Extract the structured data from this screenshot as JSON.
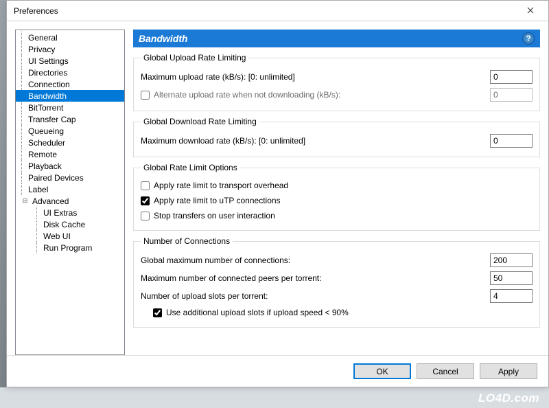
{
  "window": {
    "title": "Preferences"
  },
  "sidebar": {
    "items": [
      {
        "label": "General"
      },
      {
        "label": "Privacy"
      },
      {
        "label": "UI Settings"
      },
      {
        "label": "Directories"
      },
      {
        "label": "Connection"
      },
      {
        "label": "Bandwidth",
        "selected": true
      },
      {
        "label": "BitTorrent"
      },
      {
        "label": "Transfer Cap"
      },
      {
        "label": "Queueing"
      },
      {
        "label": "Scheduler"
      },
      {
        "label": "Remote"
      },
      {
        "label": "Playback"
      },
      {
        "label": "Paired Devices"
      },
      {
        "label": "Label"
      },
      {
        "label": "Advanced",
        "expandable": true,
        "expanded": true,
        "children": [
          {
            "label": "UI Extras"
          },
          {
            "label": "Disk Cache"
          },
          {
            "label": "Web UI"
          },
          {
            "label": "Run Program"
          }
        ]
      }
    ]
  },
  "panel": {
    "title": "Bandwidth",
    "groups": {
      "upload": {
        "legend": "Global Upload Rate Limiting",
        "max_label": "Maximum upload rate (kB/s): [0: unlimited]",
        "max_value": "0",
        "alt_label": "Alternate upload rate when not downloading (kB/s):",
        "alt_checked": false,
        "alt_value": "0"
      },
      "download": {
        "legend": "Global Download Rate Limiting",
        "max_label": "Maximum download rate (kB/s): [0: unlimited]",
        "max_value": "0"
      },
      "options": {
        "legend": "Global Rate Limit Options",
        "overhead_label": "Apply rate limit to transport overhead",
        "overhead_checked": false,
        "utp_label": "Apply rate limit to uTP connections",
        "utp_checked": true,
        "stop_label": "Stop transfers on user interaction",
        "stop_checked": false
      },
      "connections": {
        "legend": "Number of Connections",
        "global_label": "Global maximum number of connections:",
        "global_value": "200",
        "peers_label": "Maximum number of connected peers per torrent:",
        "peers_value": "50",
        "slots_label": "Number of upload slots per torrent:",
        "slots_value": "4",
        "additional_label": "Use additional upload slots if upload speed < 90%",
        "additional_checked": true
      }
    }
  },
  "buttons": {
    "ok": "OK",
    "cancel": "Cancel",
    "apply": "Apply"
  },
  "watermark": "LO4D.com"
}
